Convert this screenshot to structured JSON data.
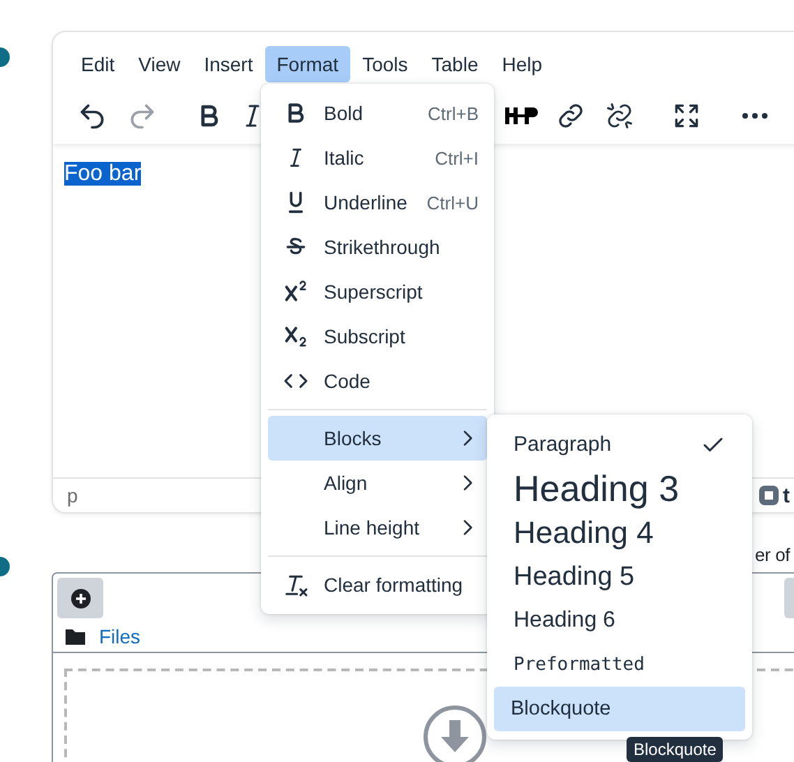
{
  "menubar": [
    {
      "label": "Edit",
      "selected": false
    },
    {
      "label": "View",
      "selected": false
    },
    {
      "label": "Insert",
      "selected": false
    },
    {
      "label": "Format",
      "selected": true
    },
    {
      "label": "Tools",
      "selected": false
    },
    {
      "label": "Table",
      "selected": false
    },
    {
      "label": "Help",
      "selected": false
    }
  ],
  "toolbar": {
    "undo": {
      "disabled": false
    },
    "redo": {
      "disabled": true
    }
  },
  "content": {
    "text": "Foo bar",
    "selected": true
  },
  "status_bar": {
    "path": "p",
    "right_text": "t"
  },
  "side_text": "er of",
  "file_picker": {
    "path_label": "Files"
  },
  "format_menu": {
    "groups": [
      [
        {
          "kind": "command",
          "label": "Bold",
          "shortcut": "Ctrl+B",
          "selected": false
        },
        {
          "kind": "command",
          "label": "Italic",
          "shortcut": "Ctrl+I",
          "selected": false
        },
        {
          "kind": "command",
          "label": "Underline",
          "shortcut": "Ctrl+U",
          "selected": false
        },
        {
          "kind": "command",
          "label": "Strikethrough",
          "selected": false
        },
        {
          "kind": "command",
          "label": "Superscript",
          "selected": false
        },
        {
          "kind": "command",
          "label": "Subscript",
          "selected": false
        },
        {
          "kind": "command",
          "label": "Code",
          "selected": false
        }
      ],
      [
        {
          "kind": "submenu",
          "label": "Blocks",
          "selected": true
        },
        {
          "kind": "submenu",
          "label": "Align",
          "selected": false
        },
        {
          "kind": "submenu",
          "label": "Line height",
          "selected": false
        }
      ],
      [
        {
          "kind": "command",
          "label": "Clear formatting",
          "selected": false
        }
      ]
    ]
  },
  "blocks_menu": {
    "items": [
      {
        "kind": "paragraph",
        "label": "Paragraph",
        "checked": true,
        "selected": false
      },
      {
        "kind": "h3",
        "label": "Heading 3",
        "checked": false,
        "selected": false
      },
      {
        "kind": "h4",
        "label": "Heading 4",
        "checked": false,
        "selected": false
      },
      {
        "kind": "h5",
        "label": "Heading 5",
        "checked": false,
        "selected": false
      },
      {
        "kind": "h6",
        "label": "Heading 6",
        "checked": false,
        "selected": false
      },
      {
        "kind": "pre",
        "label": "Preformatted",
        "checked": false,
        "selected": false
      },
      {
        "kind": "blockquote",
        "label": "Blockquote",
        "checked": false,
        "selected": true
      }
    ]
  },
  "tooltip": "Blockquote"
}
